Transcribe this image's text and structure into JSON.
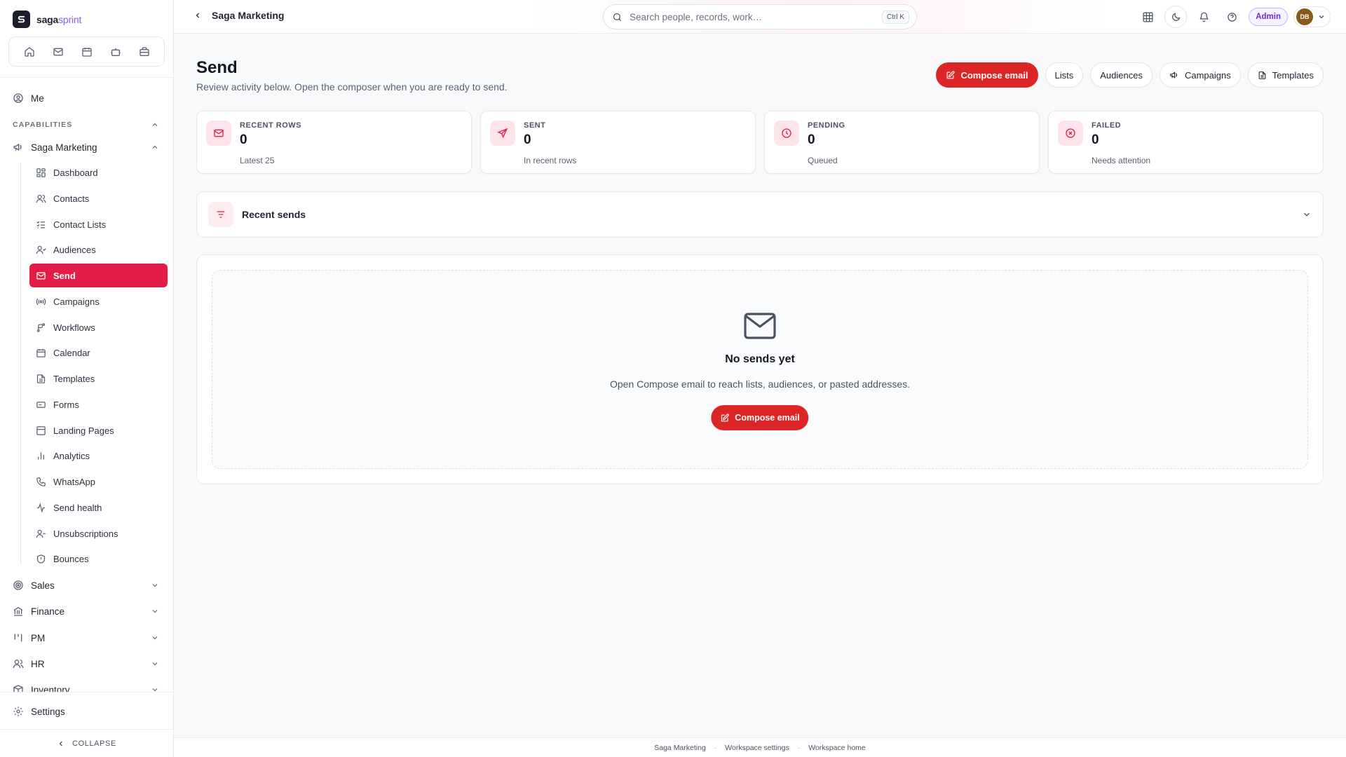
{
  "brand": {
    "name_a": "saga",
    "name_b": "sprint"
  },
  "quick_nav": [
    "home-icon",
    "mail-icon",
    "calendar-icon",
    "bot-icon",
    "briefcase-icon"
  ],
  "sidebar": {
    "me": "Me",
    "capabilities_label": "CAPABILITIES",
    "group_title": "Saga Marketing",
    "items": [
      {
        "label": "Dashboard",
        "icon": "dashboard-icon"
      },
      {
        "label": "Contacts",
        "icon": "contacts-icon"
      },
      {
        "label": "Contact Lists",
        "icon": "list-check-icon"
      },
      {
        "label": "Audiences",
        "icon": "audiences-icon"
      },
      {
        "label": "Send",
        "icon": "mail-icon",
        "active": true
      },
      {
        "label": "Campaigns",
        "icon": "broadcast-icon"
      },
      {
        "label": "Workflows",
        "icon": "workflow-icon"
      },
      {
        "label": "Calendar",
        "icon": "calendar-icon"
      },
      {
        "label": "Templates",
        "icon": "file-text-icon"
      },
      {
        "label": "Forms",
        "icon": "form-icon"
      },
      {
        "label": "Landing Pages",
        "icon": "layout-icon"
      },
      {
        "label": "Analytics",
        "icon": "bar-chart-icon"
      },
      {
        "label": "WhatsApp",
        "icon": "phone-icon"
      },
      {
        "label": "Send health",
        "icon": "activity-icon"
      },
      {
        "label": "Unsubscriptions",
        "icon": "user-minus-icon"
      },
      {
        "label": "Bounces",
        "icon": "shield-icon"
      }
    ],
    "groups": [
      {
        "label": "Sales",
        "icon": "target-icon"
      },
      {
        "label": "Finance",
        "icon": "bank-icon"
      },
      {
        "label": "PM",
        "icon": "kanban-icon"
      },
      {
        "label": "HR",
        "icon": "users-icon"
      },
      {
        "label": "Inventory",
        "icon": "box-icon"
      }
    ],
    "settings": "Settings",
    "collapse": "COLLAPSE"
  },
  "topbar": {
    "breadcrumb": "Saga Marketing",
    "search_placeholder": "Search people, records, work…",
    "shortcut": "Ctrl K",
    "admin_badge": "Admin",
    "avatar_initials": "DB"
  },
  "page": {
    "title": "Send",
    "subtitle": "Review activity below. Open the composer when you are ready to send.",
    "actions": {
      "compose": "Compose email",
      "lists": "Lists",
      "audiences": "Audiences",
      "campaigns": "Campaigns",
      "templates": "Templates"
    }
  },
  "stats": [
    {
      "label": "RECENT ROWS",
      "value": "0",
      "hint": "Latest 25",
      "icon": "mail-icon"
    },
    {
      "label": "SENT",
      "value": "0",
      "hint": "In recent rows",
      "icon": "send-icon"
    },
    {
      "label": "PENDING",
      "value": "0",
      "hint": "Queued",
      "icon": "clock-icon"
    },
    {
      "label": "FAILED",
      "value": "0",
      "hint": "Needs attention",
      "icon": "x-circle-icon"
    }
  ],
  "recent_sends": {
    "title": "Recent sends"
  },
  "empty_state": {
    "title": "No sends yet",
    "description": "Open Compose email to reach lists, audiences, or pasted addresses.",
    "button": "Compose email"
  },
  "footer": {
    "links": [
      "Saga Marketing",
      "Workspace settings",
      "Workspace home"
    ],
    "separator": "·"
  },
  "colors": {
    "accent": "#e11d48",
    "primary_button": "#dc2626",
    "admin": "#6d28d9"
  }
}
